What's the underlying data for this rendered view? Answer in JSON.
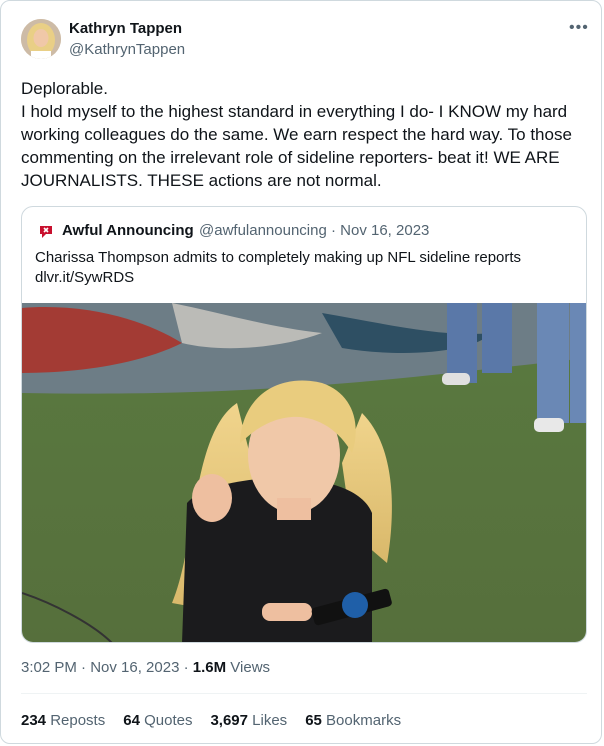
{
  "author": {
    "name": "Kathryn Tappen",
    "handle": "@KathrynTappen"
  },
  "more_icon": "ellipsis-icon",
  "tweet": {
    "text": "Deplorable.\nI hold myself to the highest standard in everything I do- I KNOW my hard working colleagues do the same. We earn respect the hard way. To those commenting on the irrelevant role of sideline reporters- beat it! WE ARE JOURNALISTS. THESE actions are not normal."
  },
  "quote": {
    "name": "Awful Announcing",
    "handle_date": "@awfulannouncing · Nov 16, 2023",
    "text": "Charissa Thompson admits to completely making up NFL sideline reports",
    "link": "dlvr.it/SywRDS",
    "icon": "awful-announcing-logo",
    "brand_color": "#c8102e"
  },
  "meta": {
    "time": "3:02 PM · Nov 16, 2023 · ",
    "views_count": "1.6M",
    "views_label": " Views"
  },
  "stats": {
    "reposts_count": "234",
    "reposts_label": " Reposts",
    "quotes_count": "64",
    "quotes_label": " Quotes",
    "likes_count": "3,697",
    "likes_label": " Likes",
    "bookmarks_count": "65",
    "bookmarks_label": " Bookmarks"
  }
}
